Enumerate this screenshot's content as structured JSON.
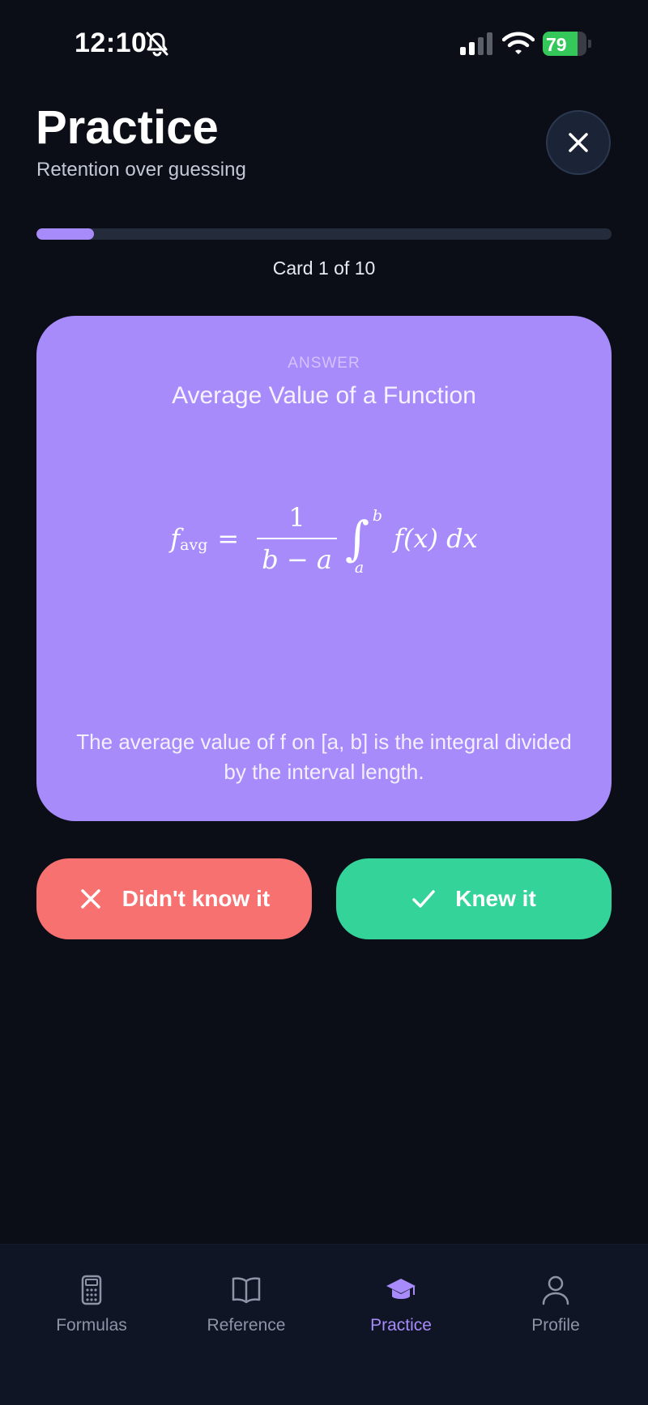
{
  "status_bar": {
    "time": "12:10",
    "battery": "79",
    "battery_level": 0.79
  },
  "header": {
    "title": "Practice",
    "subtitle": "Retention over guessing"
  },
  "progress": {
    "label": "Card 1 of 10",
    "fraction": 0.1
  },
  "card": {
    "kicker": "ANSWER",
    "title": "Average Value of a Function",
    "formula": {
      "lhs": "f",
      "lhs_sub": "avg",
      "num": "1",
      "den": "b − a",
      "upper": "b",
      "lower": "a",
      "integrand": "f(x) dx"
    },
    "description": "The average value of f on [a, b] is the integral divided by the interval length."
  },
  "actions": {
    "dont_know": "Didn't know it",
    "knew": "Knew it"
  },
  "tabs": [
    {
      "label": "Formulas",
      "icon": "calculator-icon"
    },
    {
      "label": "Reference",
      "icon": "book-icon"
    },
    {
      "label": "Practice",
      "icon": "graduation-cap-icon",
      "active": true
    },
    {
      "label": "Profile",
      "icon": "user-icon"
    }
  ],
  "colors": {
    "accent": "#a78bfa",
    "danger": "#f87171",
    "success": "#34d399",
    "background": "#0b0e17"
  }
}
